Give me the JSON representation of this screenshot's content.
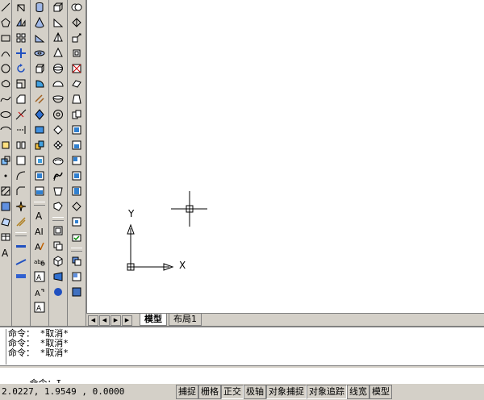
{
  "layout_tabs": {
    "model": "模型",
    "layout1": "布局1"
  },
  "ucs": {
    "x_label": "X",
    "y_label": "Y"
  },
  "command_history": [
    "命令： *取消*",
    "命令： *取消*",
    "命令： *取消*"
  ],
  "command_prompt": "命令：",
  "command_input": "I",
  "status": {
    "coordinates": "2.0227,  1.9549 , 0.0000",
    "buttons": [
      "捕捉",
      "栅格",
      "正交",
      "极轴",
      "对象捕捉",
      "对象追踪",
      "线宽",
      "模型"
    ]
  },
  "toolbars": {
    "draw": [
      "line-icon",
      "polygon-icon",
      "rectangle-icon",
      "arc-icon",
      "circle-icon",
      "revcloud-icon",
      "spline-icon",
      "ellipse-icon",
      "ellipse-arc-icon",
      "insert-block-icon",
      "make-block-icon",
      "point-icon",
      "hatch-icon",
      "gradient-icon",
      "region-icon",
      "table-icon",
      "mtext-icon"
    ],
    "modify": [
      "erase-icon",
      "copy-icon",
      "mirror-icon",
      "offset-icon",
      "array-icon",
      "move-icon",
      "rotate-icon",
      "scale-icon",
      "stretch-icon",
      "trim-icon",
      "extend-icon",
      "break-at-point-icon",
      "break-icon",
      "join-icon",
      "chamfer-icon",
      "fillet-icon",
      "explode-icon"
    ]
  }
}
